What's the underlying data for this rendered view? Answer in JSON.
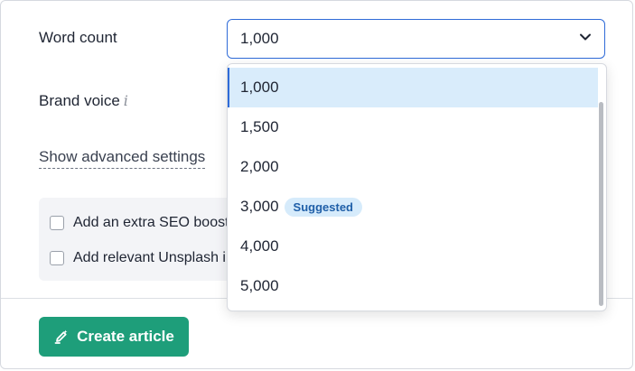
{
  "form": {
    "word_count_label": "Word count",
    "word_count_value": "1,000",
    "brand_voice_label": "Brand voice",
    "brand_voice_info_glyph": "i",
    "advanced_link": "Show advanced settings",
    "options": [
      {
        "label": "Add an extra SEO boost",
        "checked": false
      },
      {
        "label": "Add relevant Unsplash images",
        "checked": false
      }
    ],
    "create_button": "Create article"
  },
  "dropdown": {
    "items": [
      {
        "label": "1,000",
        "selected": true
      },
      {
        "label": "1,500"
      },
      {
        "label": "2,000"
      },
      {
        "label": "3,000",
        "badge": "Suggested"
      },
      {
        "label": "4,000"
      },
      {
        "label": "5,000"
      }
    ]
  },
  "colors": {
    "accent": "#1e9e7a",
    "focus": "#2f6bd8",
    "selected_bg": "#d9ecfb",
    "badge_bg": "#d6ebfb",
    "badge_text": "#1f5fa8"
  },
  "icons": {
    "select_chevron": "chevron-down-icon",
    "create_button_icon": "pencil-sparkle-icon",
    "brand_voice_info": "info-icon"
  }
}
